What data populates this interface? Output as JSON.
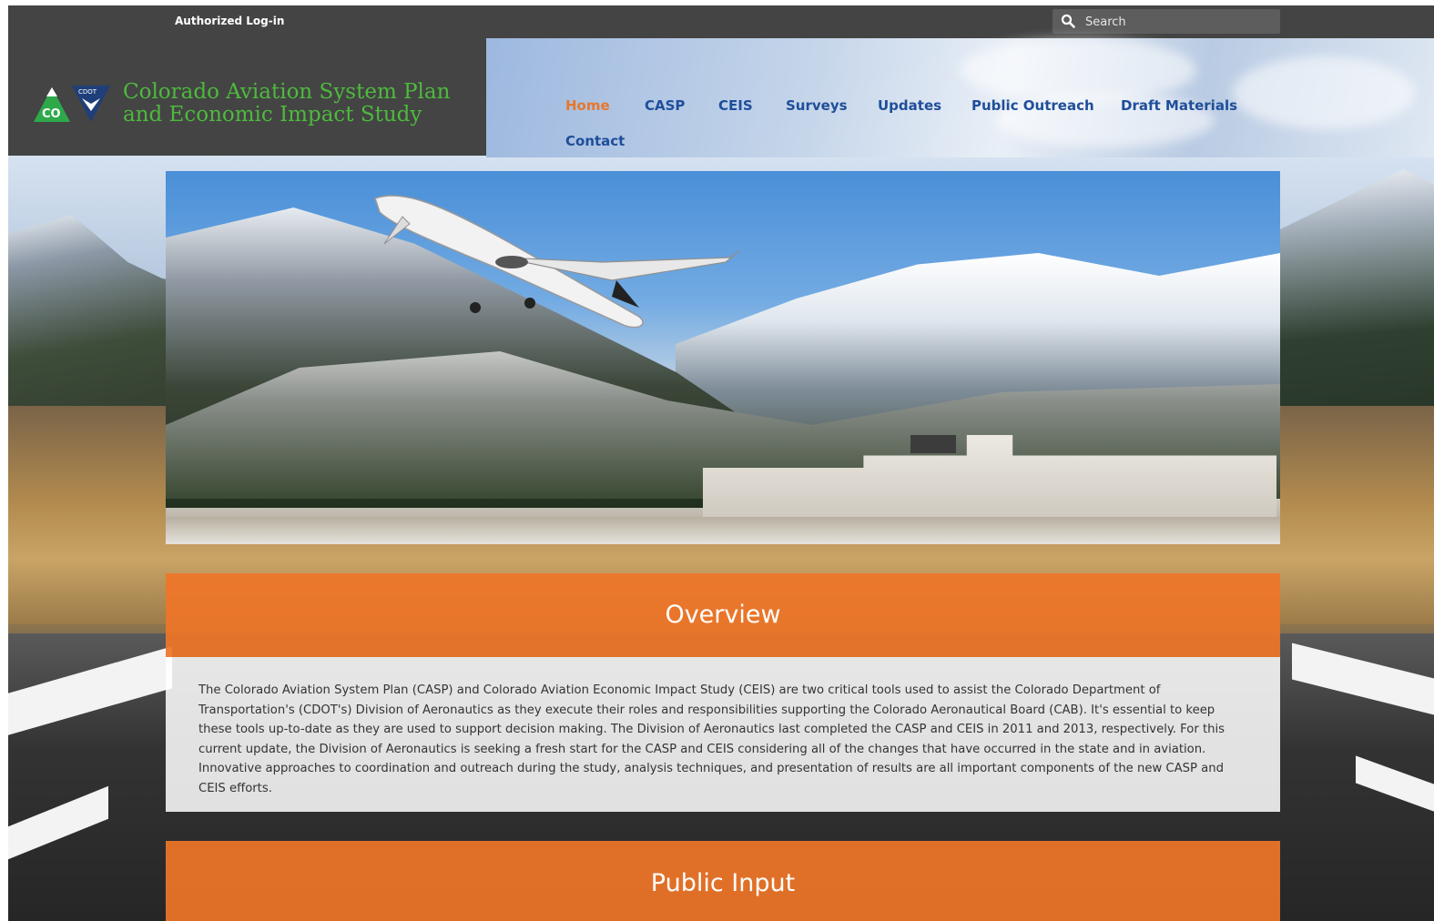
{
  "topbar": {
    "login_label": "Authorized Log-in",
    "search_placeholder": "Search",
    "search_icon": "search-icon"
  },
  "header": {
    "logo_text": "CDOT",
    "logo_state": "CO",
    "title_line1": "Colorado Aviation System Plan",
    "title_line2": "and Economic Impact Study",
    "title_color": "#4dba3d"
  },
  "nav": {
    "items": [
      {
        "label": "Home",
        "active": true
      },
      {
        "label": "CASP"
      },
      {
        "label": "CEIS"
      },
      {
        "label": "Surveys"
      },
      {
        "label": "Updates"
      },
      {
        "label": "Public Outreach"
      },
      {
        "label": "Draft Materials"
      },
      {
        "label": "Contact"
      }
    ],
    "link_color": "#1f4e9a",
    "active_color": "#e8772c"
  },
  "sections": {
    "overview": {
      "title": "Overview",
      "body": "The Colorado Aviation System Plan (CASP) and Colorado Aviation Economic Impact Study (CEIS) are two critical tools used to assist the Colorado Department of Transportation's (CDOT's) Division of Aeronautics as they execute their roles and responsibilities supporting the Colorado Aeronautical Board (CAB). It's essential to keep these tools up-to-date as they are used to support decision making. The Division of Aeronautics last completed the CASP and CEIS in 2011 and 2013, respectively. For this current update, the Division of Aeronautics is seeking a fresh start for the CASP and CEIS considering all of the changes that have occurred in the state and in aviation. Innovative approaches to coordination and outreach during the study, analysis techniques, and presentation of results are all important components of the new CASP and CEIS efforts."
    },
    "public_input": {
      "title": "Public Input"
    },
    "accent_color": "#ee7528"
  }
}
